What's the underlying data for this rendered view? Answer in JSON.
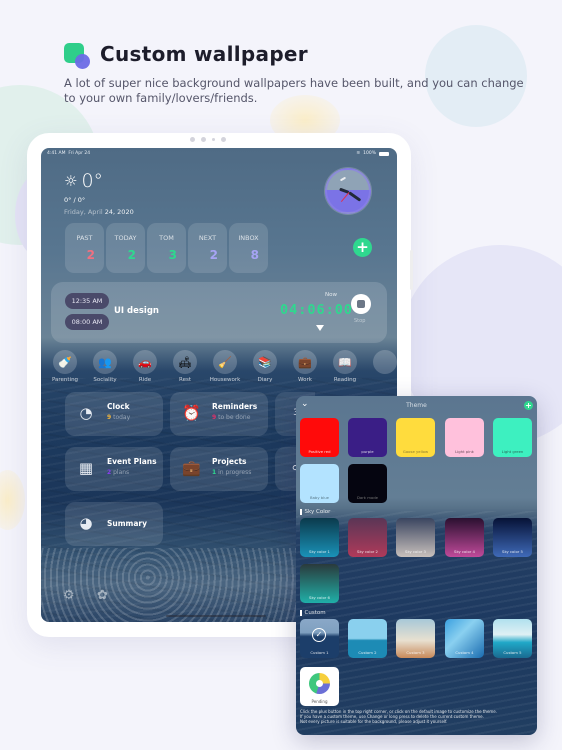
{
  "header": {
    "title": "Custom wallpaper",
    "description": "A lot of super nice background wallpapers have been built, and you can change to your own family/lovers/friends."
  },
  "status_bar": {
    "time": "4:41 AM",
    "date": "Fri Apr 24",
    "battery": "100%"
  },
  "weather": {
    "icon": "sun-icon",
    "temperature": "0°",
    "range": "0° / 0°",
    "date_prefix": "Friday, April ",
    "date_highlight": "24, 2020"
  },
  "counts": [
    {
      "label": "PAST",
      "value": "2",
      "color": "#f07080"
    },
    {
      "label": "TODAY",
      "value": "2",
      "color": "#2fd88f"
    },
    {
      "label": "TOM",
      "value": "3",
      "color": "#2fd88f"
    },
    {
      "label": "NEXT",
      "value": "2",
      "color": "#a6a4f4"
    },
    {
      "label": "INBOX",
      "value": "8",
      "color": "#a6a4f4"
    }
  ],
  "add_button": "+",
  "timer": {
    "start_time": "12:35 AM",
    "end_time": "08:00 AM",
    "task": "UI design",
    "now_label": "Now",
    "value": "04:06:00",
    "stop_label": "Stop"
  },
  "categories": [
    {
      "label": "Parenting",
      "icon": "🍼"
    },
    {
      "label": "Sociality",
      "icon": "👥"
    },
    {
      "label": "Ride",
      "icon": "🚗"
    },
    {
      "label": "Rest",
      "icon": "🛋"
    },
    {
      "label": "Housework",
      "icon": "🧹"
    },
    {
      "label": "Diary",
      "icon": "📚"
    },
    {
      "label": "Work",
      "icon": "💼"
    },
    {
      "label": "Reading",
      "icon": "📖"
    }
  ],
  "tiles": [
    {
      "title": "Clock",
      "count": "9",
      "suffix": " today",
      "count_color": "#f2b63c",
      "icon": "◔"
    },
    {
      "title": "Reminders",
      "count": "9",
      "suffix": " to be done",
      "count_color": "#e0306a",
      "icon": "⏰"
    },
    {
      "title": "Event Plans",
      "count": "2",
      "suffix": " plans",
      "count_color": "#8a3df0",
      "icon": "▦"
    },
    {
      "title": "Projects",
      "count": "1",
      "suffix": " in progress",
      "count_color": "#2fd88f",
      "icon": "💼"
    },
    {
      "title": "Summary",
      "icon": "◕"
    }
  ],
  "partial_tiles": [
    "3",
    "♂"
  ],
  "theme_panel": {
    "title": "Theme",
    "add": "+",
    "colors": [
      {
        "label": "Positive red",
        "color": "#ff0a0a"
      },
      {
        "label": "purple",
        "color": "#3a1e86"
      },
      {
        "label": "Goose yellow",
        "color": "#ffdc3d"
      },
      {
        "label": "Light pink",
        "color": "#ffc1dc"
      },
      {
        "label": "Light green",
        "color": "#3df0c0"
      },
      {
        "label": "Baby blue",
        "color": "#b3e3ff"
      },
      {
        "label": "Dark mode",
        "color": "#050510"
      }
    ],
    "sky_section": "Sky Color",
    "sky_colors": [
      {
        "label": "Sky color 1",
        "from": "#0b3a4c",
        "to": "#1a92b8"
      },
      {
        "label": "Sky color 2",
        "from": "#5a3656",
        "to": "#b03a5a"
      },
      {
        "label": "Sky color 3",
        "from": "#3a4560",
        "to": "#c8c0bc"
      },
      {
        "label": "Sky color 4",
        "from": "#2a1030",
        "to": "#c04a9a"
      },
      {
        "label": "Sky color 5",
        "from": "#061236",
        "to": "#3f6ab8"
      },
      {
        "label": "Sky color 6",
        "from": "#2a3a3c",
        "to": "#20b0a8"
      }
    ],
    "custom_section": "Custom",
    "custom_images": [
      {
        "label": "Custom 1",
        "selected": true,
        "from": "#7fa0c0",
        "to": "#1c3e6a"
      },
      {
        "label": "Custom 2",
        "selected": false,
        "from": "#8ad0ee",
        "to": "#1d8bb5"
      },
      {
        "label": "Custom 3",
        "selected": false,
        "from": "#a8c8d8",
        "to": "#c88a5a"
      },
      {
        "label": "Custom 4",
        "selected": false,
        "from": "#3aa0e0",
        "to": "#1a6cb0"
      },
      {
        "label": "Custom 5",
        "selected": false,
        "from": "#b0e0ee",
        "to": "#20a8c8"
      }
    ],
    "pending_label": "Pending",
    "help_lines": [
      "Click the plus button in the top right corner, or click on the default image to customize the theme.",
      "If you have a custom theme, use Change or long press to delete the current custom theme.",
      "Not every picture is suitable for the background, please adjust it yourself."
    ]
  }
}
